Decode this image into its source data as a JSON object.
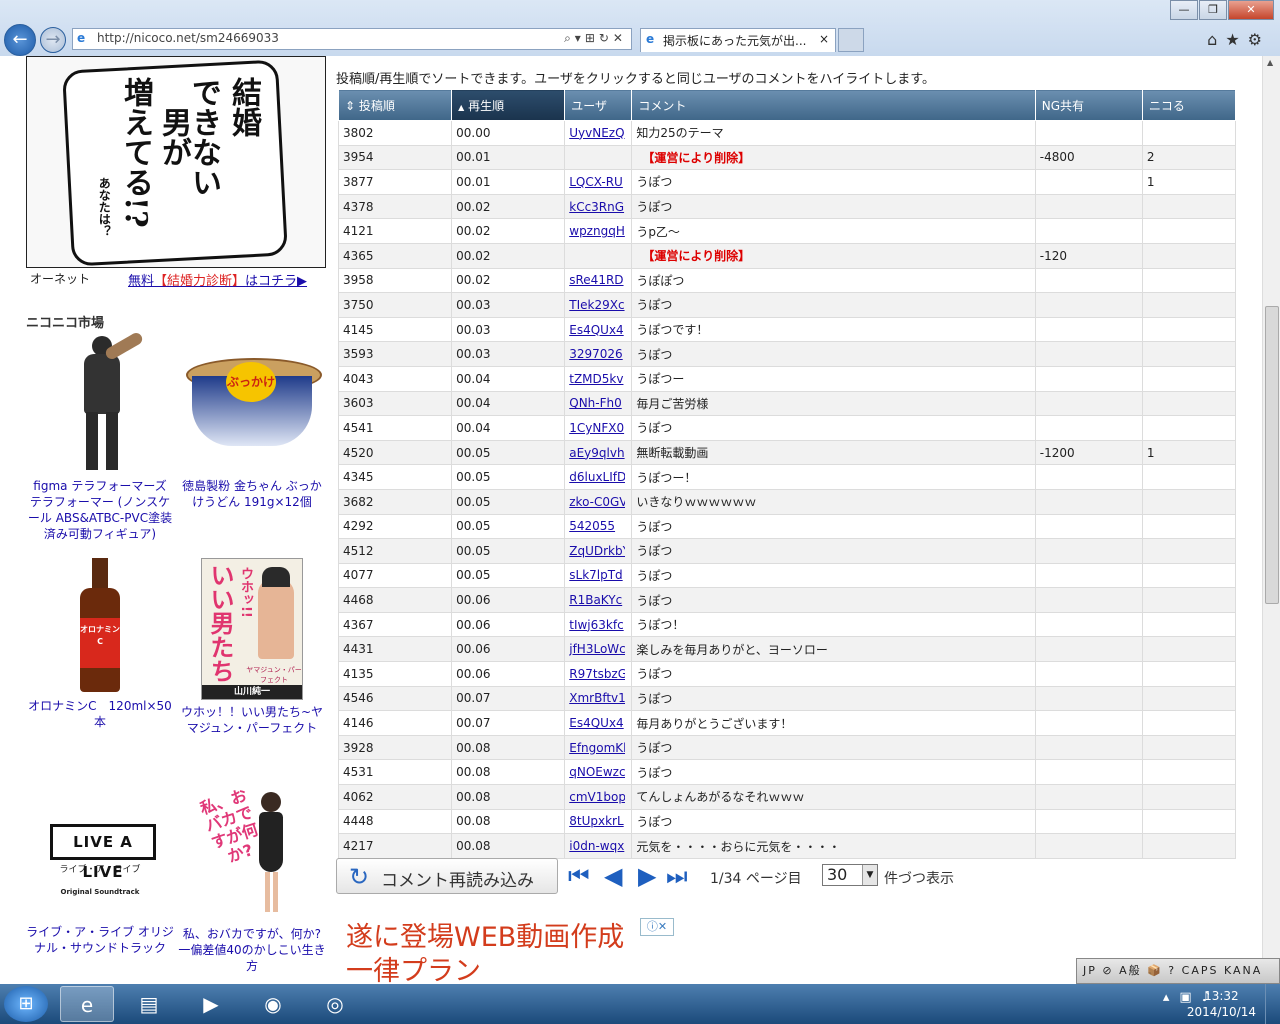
{
  "browser": {
    "url": "http://nicoco.net/sm24669033",
    "tab_title": "掲示板にあった元気が出...",
    "tab_close": "×"
  },
  "left_ad": {
    "headline_col1": "結婚",
    "headline_col2": "できない",
    "headline_col3": "男が",
    "headline_col4": "増えてる!?",
    "small_text": "あなたは？",
    "brand": "オーネット",
    "link_prefix": "無料",
    "link_highlight": "【結婚力診断】",
    "link_suffix": "はコチラ▶"
  },
  "market": {
    "title": "ニコニコ市場",
    "products": [
      {
        "caption": "figma テラフォーマーズ テラフォーマー (ノンスケール ABS&ATBC-PVC塗装済み可動フィギュア)"
      },
      {
        "caption": "徳島製粉 金ちゃん ぶっかけうどん 191g×12個"
      },
      {
        "caption": "オロナミンC　120ml×50本"
      },
      {
        "caption": "ウホッ！！いい男たち~ヤマジュン・パーフェクト"
      },
      {
        "caption": "ライブ・ア・ライブ オリジナル・サウンドトラック"
      },
      {
        "caption": "私、おバカですが、何か? 一偏差値40のかしこい生き方"
      }
    ],
    "img_text": {
      "cup": "ぶっかけ",
      "bottle": "オロナミンC",
      "book_title": "いい男たち",
      "book_sub": "ウホッ!!",
      "book_author": "山川純一",
      "book_band": "ヤマジュン・パーフェクト",
      "live_logo": "LIVE A LIVE",
      "live_sub": "ライブ・ア・ライブ",
      "live_ost": "Original Soundtrack",
      "baka_title": "私、おバカですが何か?"
    }
  },
  "main": {
    "description": "投稿順/再生順でソートできます。ユーザをクリックすると同じユーザのコメントをハイライトします。",
    "columns": [
      "投稿順",
      "再生順",
      "ユーザ",
      "コメント",
      "NG共有",
      "ニコる"
    ],
    "sort_icons": [
      "⇕",
      "▲"
    ],
    "rows": [
      [
        "3802",
        "00.00",
        "UyvNEzQ",
        "知力25のテーマ",
        "",
        ""
      ],
      [
        "3954",
        "00.01",
        "",
        "【運営により削除】",
        "-4800",
        "2"
      ],
      [
        "3877",
        "00.01",
        "LQCX-RU",
        "うぽつ",
        "",
        "1"
      ],
      [
        "4378",
        "00.02",
        "kCc3RnG",
        "うぽつ",
        "",
        ""
      ],
      [
        "4121",
        "00.02",
        "wpzngqH",
        "うp乙～",
        "",
        ""
      ],
      [
        "4365",
        "00.02",
        "",
        "【運営により削除】",
        "-120",
        ""
      ],
      [
        "3958",
        "00.02",
        "sRe41RD",
        "うぽぽつ",
        "",
        ""
      ],
      [
        "3750",
        "00.03",
        "TIek29Xc",
        "うぽつ",
        "",
        ""
      ],
      [
        "4145",
        "00.03",
        "Es4QUx4",
        "うぽつです！",
        "",
        ""
      ],
      [
        "3593",
        "00.03",
        "3297026",
        "うぽつ",
        "",
        ""
      ],
      [
        "4043",
        "00.04",
        "tZMD5kv",
        "うぽつー",
        "",
        ""
      ],
      [
        "3603",
        "00.04",
        "QNh-Fh0",
        "毎月ご苦労様",
        "",
        ""
      ],
      [
        "4541",
        "00.04",
        "1CyNFX0",
        "うぽつ",
        "",
        ""
      ],
      [
        "4520",
        "00.05",
        "aEy9qlvh",
        "無断転載動画",
        "-1200",
        "1"
      ],
      [
        "4345",
        "00.05",
        "d6luxLIfD",
        "うぽつー！",
        "",
        ""
      ],
      [
        "3682",
        "00.05",
        "zko-C0GV",
        "いきなりｗｗｗｗｗｗ",
        "",
        ""
      ],
      [
        "4292",
        "00.05",
        "542055",
        "うぽつ",
        "",
        ""
      ],
      [
        "4512",
        "00.05",
        "ZqUDrkbY",
        "うぽつ",
        "",
        ""
      ],
      [
        "4077",
        "00.05",
        "sLk7lpTd",
        "うぽつ",
        "",
        ""
      ],
      [
        "4468",
        "00.06",
        "R1BaKYc",
        "うぽつ",
        "",
        ""
      ],
      [
        "4367",
        "00.06",
        "tIwj63kfc",
        "うぽつ！",
        "",
        ""
      ],
      [
        "4431",
        "00.06",
        "jfH3LoWc",
        "楽しみを毎月ありがと、ヨーソロー",
        "",
        ""
      ],
      [
        "4135",
        "00.06",
        "R97tsbzG",
        "うぽつ",
        "",
        ""
      ],
      [
        "4546",
        "00.07",
        "XmrBftv1",
        "うぽつ",
        "",
        ""
      ],
      [
        "4146",
        "00.07",
        "Es4QUx4",
        "毎月ありがとうございます！",
        "",
        ""
      ],
      [
        "3928",
        "00.08",
        "EfngomKl",
        "うぽつ",
        "",
        ""
      ],
      [
        "4531",
        "00.08",
        "qNOEwzc",
        "うぽつ",
        "",
        ""
      ],
      [
        "4062",
        "00.08",
        "cmV1bop",
        "てんしょんあがるなそれｗｗｗ",
        "",
        ""
      ],
      [
        "4448",
        "00.08",
        "8tUpxkrL",
        "うぽつ",
        "",
        ""
      ],
      [
        "4217",
        "00.08",
        "i0dn-wqx",
        "元気を・・・・おらに元気を・・・・",
        "",
        ""
      ]
    ],
    "reload_label": "コメント再読み込み",
    "page_info": "1/34 ページ目",
    "per_page_value": "30",
    "per_page_label": "件づつ表示"
  },
  "bottom_ad": {
    "text": "遂に登場WEB動画作成一律プラン",
    "adchoice": "ⓘ✕"
  },
  "ime_bar": {
    "text": "JP ⊘ A般 📦 ? CAPS KANA"
  },
  "taskbar": {
    "clock_time": "13:32",
    "clock_date": "2014/10/14"
  }
}
